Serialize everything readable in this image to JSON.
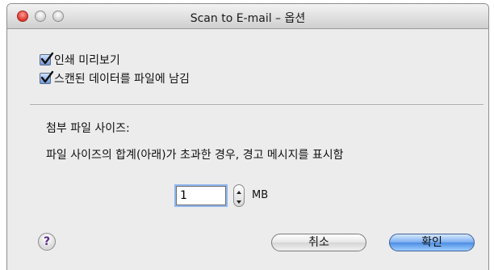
{
  "window": {
    "title": "Scan to E-mail – 옵션"
  },
  "options": [
    {
      "label": "인쇄 미리보기",
      "checked": true
    },
    {
      "label": "스캔된 데이터를 파일에 남김",
      "checked": true
    }
  ],
  "attachment": {
    "heading": "첨부 파일 사이즈:",
    "description": "파일 사이즈의 합계(아래)가 초과한 경우, 경고 메시지를 표시함",
    "size_value": "1",
    "unit": "MB"
  },
  "buttons": {
    "help": "?",
    "cancel": "취소",
    "ok": "확인"
  },
  "colors": {
    "default_button": "#5a95e6",
    "close_button": "#d9362c"
  },
  "icons": {
    "close": "close-icon",
    "minimize": "minimize-icon",
    "zoom": "zoom-icon",
    "checkmark": "checkmark-icon",
    "stepper_up": "chevron-up-icon",
    "stepper_down": "chevron-down-icon",
    "help": "question-mark-icon"
  }
}
